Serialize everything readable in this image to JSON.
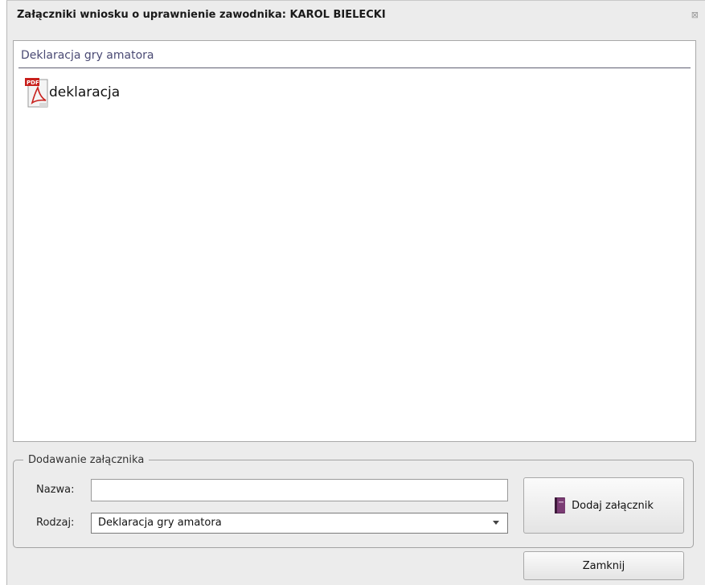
{
  "window": {
    "title": "Załączniki wniosku o uprawnienie zawodnika: KAROL BIELECKI",
    "close_glyph": "⊠"
  },
  "attachments": {
    "group_label": "Deklaracja gry amatora",
    "files": [
      {
        "name": "deklaracja",
        "icon": "pdf-icon"
      }
    ]
  },
  "add_form": {
    "legend": "Dodawanie załącznika",
    "name_label": "Nazwa:",
    "name_value": "",
    "type_label": "Rodzaj:",
    "type_selected": "Deklaracja gry amatora",
    "add_button": {
      "label": "Dodaj załącznik",
      "icon": "book-icon"
    }
  },
  "footer": {
    "close_button": "Zamknij"
  },
  "colors": {
    "dialog_bg": "#ececec",
    "group_label": "#4a4a74",
    "pdf_red": "#c8201c"
  }
}
